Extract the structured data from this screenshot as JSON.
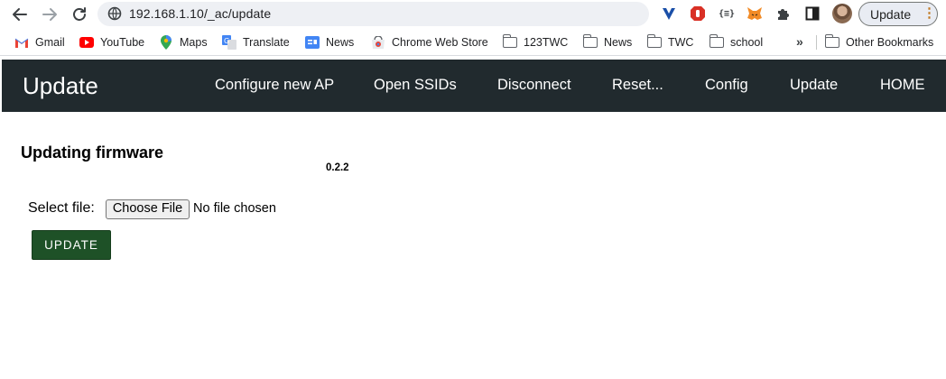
{
  "browser": {
    "url": "192.168.1.10/_ac/update",
    "update_button_label": "Update"
  },
  "bookmarks": {
    "items": [
      {
        "label": "Gmail",
        "icon": "gmail-icon"
      },
      {
        "label": "YouTube",
        "icon": "youtube-icon"
      },
      {
        "label": "Maps",
        "icon": "maps-icon"
      },
      {
        "label": "Translate",
        "icon": "translate-icon"
      },
      {
        "label": "News",
        "icon": "google-news-icon"
      },
      {
        "label": "Chrome Web Store",
        "icon": "chrome-web-store-icon"
      },
      {
        "label": "123TWC",
        "icon": "folder-icon"
      },
      {
        "label": "News",
        "icon": "folder-icon"
      },
      {
        "label": "TWC",
        "icon": "folder-icon"
      },
      {
        "label": "school",
        "icon": "folder-icon"
      }
    ],
    "overflow": "»",
    "other": "Other Bookmarks"
  },
  "navbar": {
    "title": "Update",
    "links": [
      "Configure new AP",
      "Open SSIDs",
      "Disconnect",
      "Reset...",
      "Config",
      "Update",
      "HOME"
    ]
  },
  "main": {
    "heading": "Updating firmware",
    "version": "0.2.2",
    "select_label": "Select file:",
    "choose_file_label": "Choose File",
    "no_file_text": "No file chosen",
    "update_button": "UPDATE"
  },
  "colors": {
    "navbar_bg": "#212a2e",
    "update_button_bg": "#1e5127",
    "omnibox_bg": "#eef0f4"
  }
}
